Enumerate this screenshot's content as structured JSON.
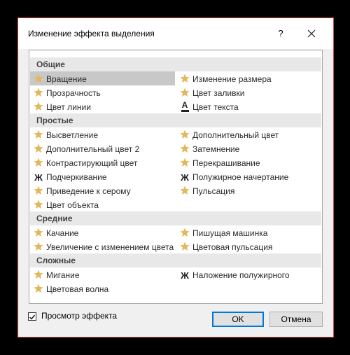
{
  "dialog": {
    "title": "Изменение эффекта выделения",
    "help_label": "?"
  },
  "groups": [
    {
      "label": "Общие",
      "items": [
        {
          "label": "Вращение",
          "icon": "star-icon",
          "selected": true
        },
        {
          "label": "Изменение размера",
          "icon": "star-icon"
        },
        {
          "label": "Прозрачность",
          "icon": "star-icon"
        },
        {
          "label": "Цвет заливки",
          "icon": "star-icon"
        },
        {
          "label": "Цвет линии",
          "icon": "star-icon"
        },
        {
          "label": "Цвет текста",
          "icon": "font-color-icon"
        }
      ]
    },
    {
      "label": "Простые",
      "items": [
        {
          "label": "Высветление",
          "icon": "star-icon"
        },
        {
          "label": "Дополнительный цвет",
          "icon": "star-icon"
        },
        {
          "label": "Дополнительный цвет 2",
          "icon": "star-icon"
        },
        {
          "label": "Затемнение",
          "icon": "star-icon"
        },
        {
          "label": "Контрастирующий цвет",
          "icon": "star-icon"
        },
        {
          "label": "Перекрашивание",
          "icon": "star-icon"
        },
        {
          "label": "Подчеркивание",
          "icon": "bold-icon"
        },
        {
          "label": "Полужирное начертание",
          "icon": "bold-icon"
        },
        {
          "label": "Приведение к серому",
          "icon": "star-icon"
        },
        {
          "label": "Пульсация",
          "icon": "star-icon"
        },
        {
          "label": "Цвет объекта",
          "icon": "star-icon"
        }
      ]
    },
    {
      "label": "Средние",
      "items": [
        {
          "label": "Качание",
          "icon": "star-icon"
        },
        {
          "label": "Пишущая машинка",
          "icon": "star-icon"
        },
        {
          "label": "Увеличение с изменением цвета",
          "icon": "star-icon"
        },
        {
          "label": "Цветовая пульсация",
          "icon": "star-icon"
        }
      ]
    },
    {
      "label": "Сложные",
      "items": [
        {
          "label": "Мигание",
          "icon": "star-icon"
        },
        {
          "label": "Наложение полужирного",
          "icon": "bold-icon"
        },
        {
          "label": "Цветовая волна",
          "icon": "star-icon"
        }
      ]
    }
  ],
  "icon_glyphs": {
    "bold": "Ж",
    "font_color": "A"
  },
  "footer": {
    "preview_label": "Просмотр эффекта",
    "preview_checked": true,
    "ok_label": "OK",
    "cancel_label": "Отмена"
  },
  "colors": {
    "star": "#e3b85b",
    "selection": "#c8c8c8",
    "window_border": "#d24b3a",
    "ok_border": "#0078d7"
  }
}
